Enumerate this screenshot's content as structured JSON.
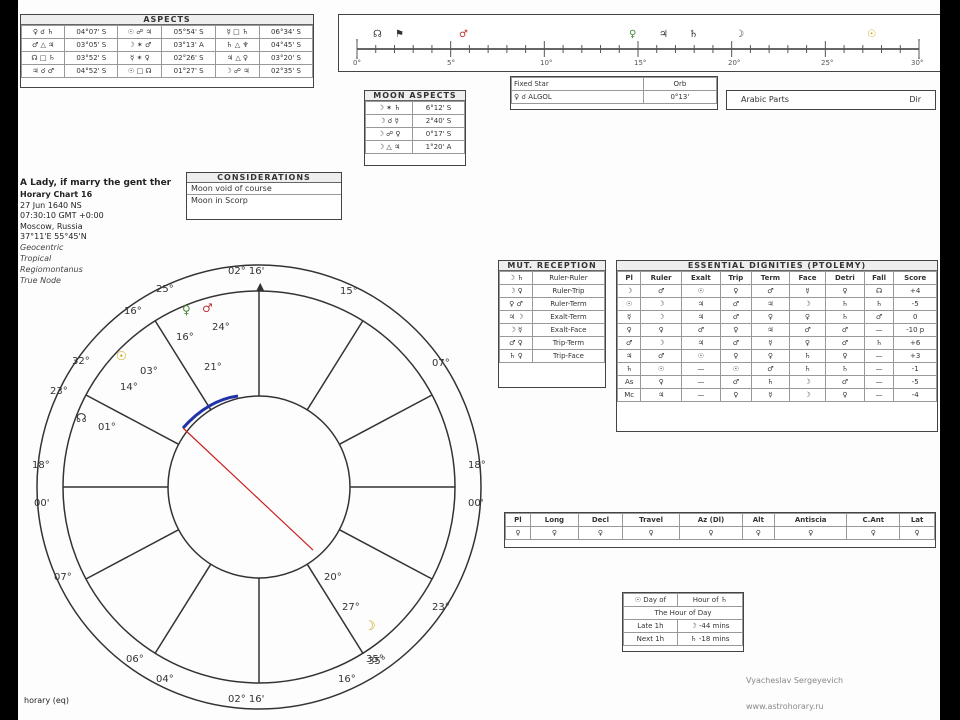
{
  "aspects_box": {
    "title": "ASPECTS",
    "rows": [
      [
        "04°07' S",
        "05°54' S",
        "06°34' S"
      ],
      [
        "03°05' S",
        "03°13' A",
        "04°45' S"
      ],
      [
        "03°52' S",
        "02°26' S",
        "03°20' S"
      ],
      [
        "04°52' S",
        "01°27' S",
        "02°35' S"
      ]
    ]
  },
  "timeline": {
    "ticks": [
      "0°",
      "5°",
      "10°",
      "15°",
      "20°",
      "25°",
      "30°"
    ]
  },
  "fixed_star": {
    "header": "Fixed Star",
    "orb_header": "Orb",
    "star": "ALGOL",
    "orb": "0°13'"
  },
  "arabic_parts": {
    "label": "Arabic Parts",
    "value": "Dir"
  },
  "moon_aspects": {
    "title": "MOON ASPECTS",
    "rows": [
      "6°12' S",
      "2°40' S",
      "0°17' S",
      "1°20' A"
    ]
  },
  "considerations": {
    "title": "CONSIDERATIONS",
    "items": [
      "Moon void of course",
      "Moon in Scorp"
    ]
  },
  "chart_info": {
    "question": "A Lady, if marry the gent ther",
    "chart_name": "Horary Chart 16",
    "date": "27 Jun 1640 NS",
    "time": "07:30:10 GMT +0:00",
    "place": "Moscow, Russia",
    "coords": "37°11'E 55°45'N",
    "line1": "Geocentric",
    "line2": "Tropical",
    "line3": "Regiomontanus",
    "line4": "True Node"
  },
  "mutual_reception": {
    "title": "MUT. RECEPTION",
    "rows": [
      "Ruler-Ruler",
      "Ruler-Trip",
      "Ruler-Term",
      "Exalt-Term",
      "Exalt-Face",
      "Trip-Term",
      "Trip-Face"
    ]
  },
  "dignities": {
    "title": "ESSENTIAL DIGNITIES (PTOLEMY)",
    "headers": [
      "Pl",
      "Ruler",
      "Exalt",
      "Trip",
      "Term",
      "Face",
      "Detri",
      "Fall",
      "Score"
    ],
    "scores": [
      "+4",
      "-5",
      "0",
      "-10 p",
      "+6",
      "+3",
      "-1",
      "-5",
      "-4"
    ]
  },
  "longitude_table": {
    "headers": [
      "Pl",
      "Long",
      "Decl",
      "Travel",
      "Az (Dl)",
      "Alt",
      "Antiscia",
      "C.Ant",
      "Lat"
    ]
  },
  "day_box": {
    "header_left": "Day of",
    "header_right": "Hour of",
    "mid": "The Hour of Day",
    "row1": "Late 1h",
    "row1_val": "-44 mins",
    "row2": "Next 1h",
    "row2_val": "-18 mins"
  },
  "wheel": {
    "mc": "02° 16'",
    "ic": "02° 16'",
    "asc_top": "18°",
    "asc_bottom": "00'",
    "desc_top": "18°",
    "desc_bottom": "00'",
    "cusps": [
      "16°",
      "25°",
      "15°",
      "07°",
      "32°",
      "23°",
      "07°",
      "23°",
      "35°",
      "16°",
      "04°",
      "06°"
    ],
    "planets": [
      "03°",
      "14°",
      "01°",
      "21°",
      "24°",
      "20°",
      "27°",
      "35°",
      "16°"
    ]
  },
  "footer": {
    "label": "horary (eq)",
    "author": "Vyacheslav Sergeyevich",
    "url": "www.astrohorary.ru"
  }
}
